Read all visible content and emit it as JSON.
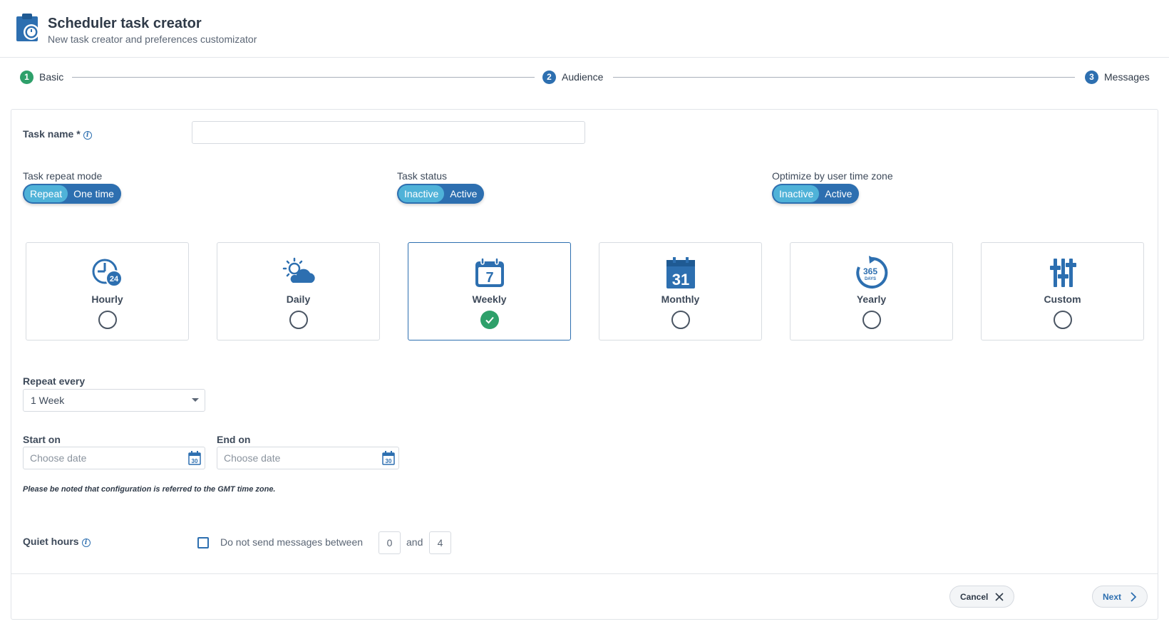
{
  "header": {
    "title": "Scheduler task creator",
    "subtitle": "New task creator and preferences customizator",
    "icon": "clipboard-timer-icon"
  },
  "stepper": [
    {
      "number": "1",
      "label": "Basic",
      "state": "done"
    },
    {
      "number": "2",
      "label": "Audience",
      "state": "todo"
    },
    {
      "number": "3",
      "label": "Messages",
      "state": "todo"
    }
  ],
  "form": {
    "task_name": {
      "label": "Task name *",
      "value": "",
      "placeholder": ""
    },
    "repeat_mode": {
      "label": "Task repeat mode",
      "options": [
        "Repeat",
        "One time"
      ],
      "selected": "Repeat"
    },
    "task_status": {
      "label": "Task status",
      "options": [
        "Inactive",
        "Active"
      ],
      "selected": "Inactive"
    },
    "optimize_tz": {
      "label": "Optimize by user time zone",
      "options": [
        "Inactive",
        "Active"
      ],
      "selected": "Inactive"
    },
    "frequencies": [
      {
        "label": "Hourly",
        "icon": "clock-24-icon",
        "selected": false
      },
      {
        "label": "Daily",
        "icon": "sun-cloud-icon",
        "selected": false
      },
      {
        "label": "Weekly",
        "icon": "calendar-7-icon",
        "selected": true
      },
      {
        "label": "Monthly",
        "icon": "calendar-31-icon",
        "selected": false
      },
      {
        "label": "Yearly",
        "icon": "365-days-icon",
        "selected": false
      },
      {
        "label": "Custom",
        "icon": "sliders-icon",
        "selected": false
      }
    ],
    "repeat_every": {
      "label": "Repeat every",
      "value": "1 Week"
    },
    "start_on": {
      "label": "Start on",
      "placeholder": "Choose date",
      "value": ""
    },
    "end_on": {
      "label": "End on",
      "placeholder": "Choose date",
      "value": ""
    },
    "calendar_icon_text": "30",
    "note": "Please be noted that configuration is referred to the GMT time zone.",
    "quiet_hours": {
      "label": "Quiet hours",
      "checkbox_text": "Do not send messages between",
      "from": "0",
      "and_text": "and",
      "to": "4",
      "checked": false
    }
  },
  "footer": {
    "cancel_label": "Cancel",
    "next_label": "Next"
  },
  "colors": {
    "primary": "#2d6fb0",
    "toggle_active": "#4fb2d8",
    "success": "#2ea06a",
    "text": "#3e4a5a"
  }
}
